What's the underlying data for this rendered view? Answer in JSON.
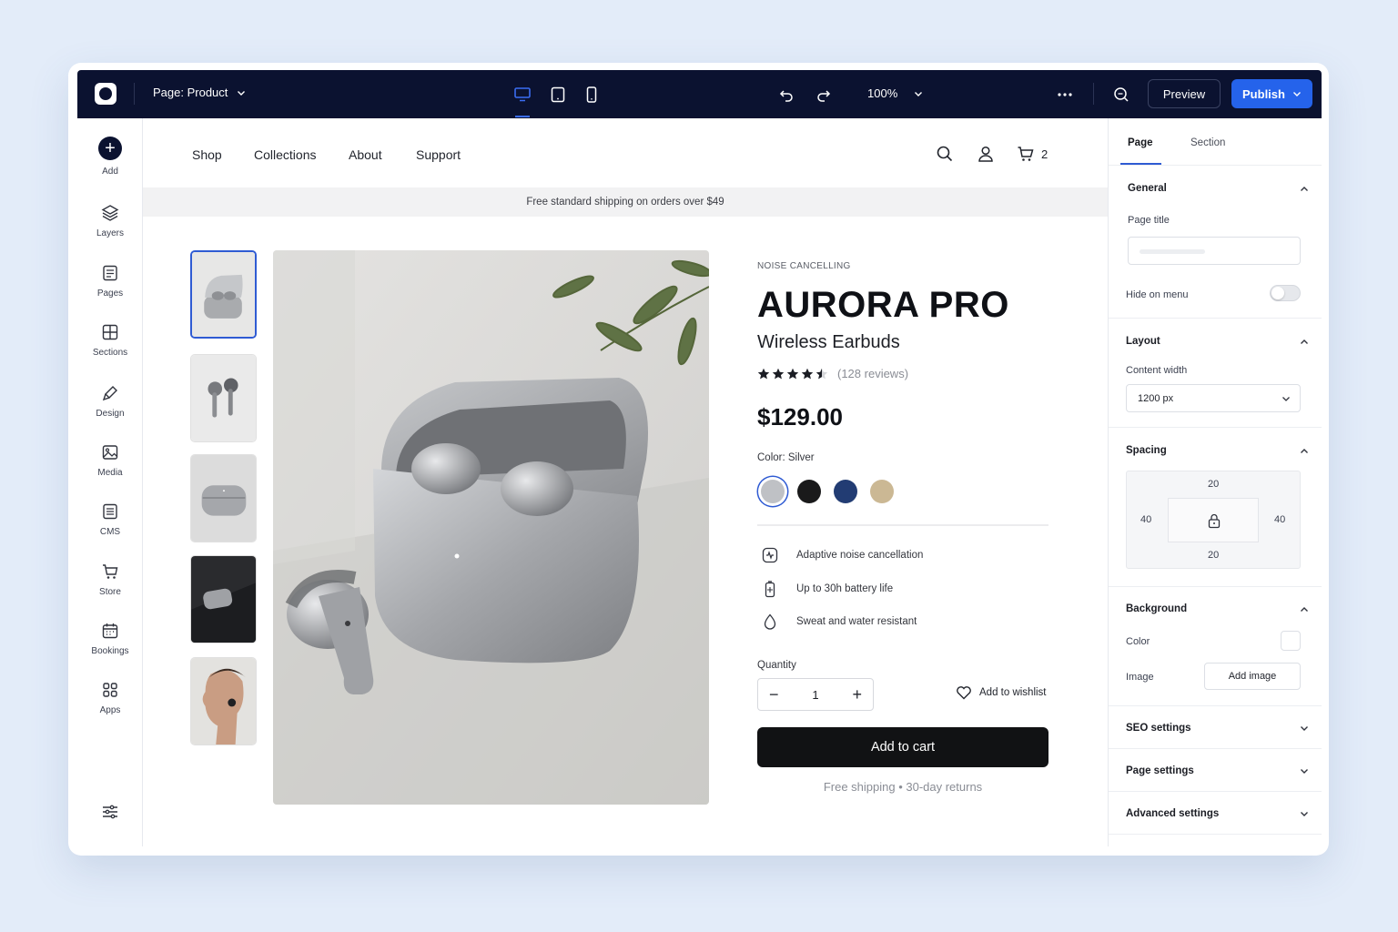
{
  "topbar": {
    "page_selector": "Page: Product",
    "zoom": "100%",
    "preview": "Preview",
    "publish": "Publish",
    "active_device": "desktop"
  },
  "rail": {
    "items": [
      "Add",
      "Layers",
      "Pages",
      "Sections",
      "Design",
      "Media",
      "CMS",
      "Store",
      "Bookings",
      "Apps"
    ]
  },
  "site": {
    "nav": [
      "Shop",
      "Collections",
      "About",
      "Support"
    ],
    "cart_count": "2",
    "promo": "Free standard shipping on orders over $49"
  },
  "product": {
    "eyebrow": "NOISE CANCELLING",
    "title": "AURORA PRO",
    "subtitle": "Wireless Earbuds",
    "rating": 4.5,
    "reviews": "(128 reviews)",
    "price": "$129.00",
    "color_label": "Color: Silver",
    "swatches": [
      {
        "name": "Silver",
        "hex": "#bfc1c5",
        "selected": true
      },
      {
        "name": "Black",
        "hex": "#1a1a1b",
        "selected": false
      },
      {
        "name": "Navy",
        "hex": "#223c73",
        "selected": false
      },
      {
        "name": "Sand",
        "hex": "#cbb894",
        "selected": false
      }
    ],
    "features": [
      "Adaptive noise cancellation",
      "Up to 30h battery life",
      "Sweat and water resistant"
    ],
    "quantity_label": "Quantity",
    "quantity": "1",
    "wishlist": "Add to wishlist",
    "add_to_cart": "Add to cart",
    "shipping_note": "Free shipping • 30-day returns"
  },
  "panel": {
    "tabs": [
      "Page",
      "Section"
    ],
    "general": {
      "title": "General",
      "page_title_label": "Page title",
      "page_title_value": "",
      "hide_on_menu": "Hide on menu"
    },
    "layout": {
      "title": "Layout",
      "content_width_label": "Content width",
      "content_width": "1200 px"
    },
    "spacing": {
      "title": "Spacing",
      "top": "20",
      "bottom": "20",
      "left": "40",
      "right": "40"
    },
    "background": {
      "title": "Background",
      "color_label": "Color",
      "image_label": "Image",
      "add_image": "Add image"
    },
    "collapsed": [
      "SEO settings",
      "Page settings",
      "Advanced settings"
    ]
  }
}
